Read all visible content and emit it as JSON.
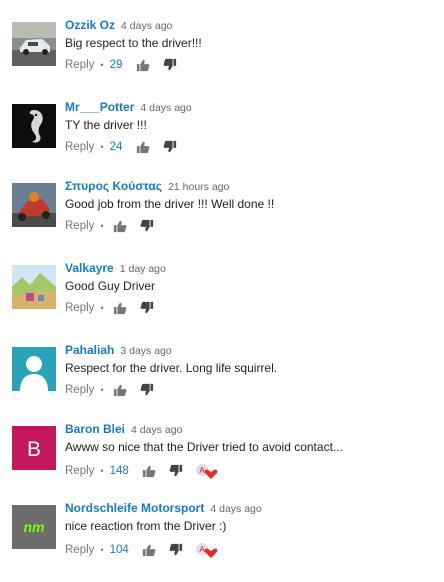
{
  "comments": [
    {
      "author": "Ozzik Oz",
      "time": "4 days ago",
      "text": "Big respect to the driver!!!",
      "reply_label": "Reply",
      "likes": "29",
      "avatar": "car-photo-avatar",
      "hearted": false
    },
    {
      "author": "Mr___Potter",
      "time": "4 days ago",
      "text": "TY the driver !!!",
      "reply_label": "Reply",
      "likes": "24",
      "avatar": "cobra-logo-avatar",
      "hearted": false
    },
    {
      "author": "Σπυρος Κούστας",
      "time": "21 hours ago",
      "text": "Good job from the driver !!! Well done !!",
      "reply_label": "Reply",
      "likes": "",
      "avatar": "motorcycle-photo-avatar",
      "hearted": false
    },
    {
      "author": "Valkayre",
      "time": "1 day ago",
      "text": "Good Guy Driver",
      "reply_label": "Reply",
      "likes": "",
      "avatar": "landscape-photo-avatar",
      "hearted": false
    },
    {
      "author": "Pahaliah",
      "time": "3 days ago",
      "text": "Respect for the driver. Long life squirrel.",
      "reply_label": "Reply",
      "likes": "",
      "avatar": "default-person-avatar",
      "hearted": false
    },
    {
      "author": "Baron Blei",
      "time": "4 days ago",
      "text": "Awww so nice that the Driver tried to avoid contact...",
      "reply_label": "Reply",
      "likes": "148",
      "avatar": "letter-avatar",
      "avatar_letter": "B",
      "hearted": true
    },
    {
      "author": "Nordschleife Motorsport",
      "time": "4 days ago",
      "text": "nice reaction from the Driver :)",
      "reply_label": "Reply",
      "likes": "104",
      "avatar": "nm-logo-avatar",
      "avatar_letter": "nm",
      "hearted": true
    }
  ],
  "colors": {
    "author": "#167ac6",
    "muted": "#767676",
    "heart": "#e52d27",
    "letter_avatar_bg": "#c2185b",
    "person_avatar_bg": "#29a3b8",
    "nm_avatar_bg": "#6d6d6d",
    "nm_logo": "#76ff03"
  }
}
